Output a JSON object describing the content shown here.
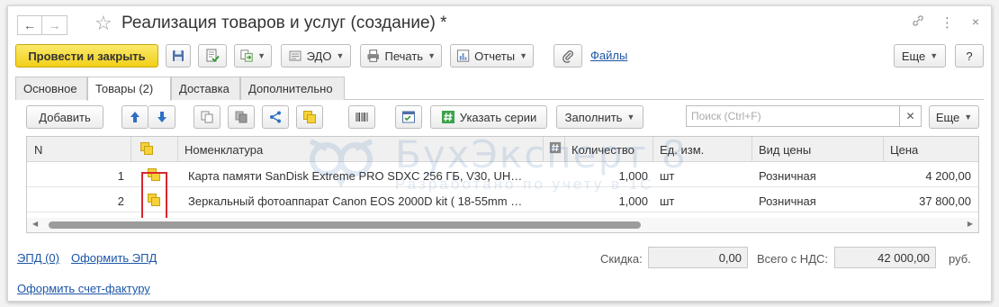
{
  "window": {
    "title": "Реализация товаров и услуг (создание) *"
  },
  "toolbar": {
    "post_and_close": "Провести и закрыть",
    "edo": "ЭДО",
    "print": "Печать",
    "reports": "Отчеты",
    "files": "Файлы",
    "more": "Еще",
    "help": "?"
  },
  "tabs": [
    {
      "label": "Основное"
    },
    {
      "label": "Товары (2)"
    },
    {
      "label": "Доставка"
    },
    {
      "label": "Дополнительно"
    }
  ],
  "table_toolbar": {
    "add": "Добавить",
    "specify_series": "Указать серии",
    "fill": "Заполнить",
    "search_placeholder": "Поиск (Ctrl+F)",
    "more": "Еще"
  },
  "grid": {
    "columns": [
      "N",
      "Номенклатура",
      "Количество",
      "Ед. изм.",
      "Вид цены",
      "Цена"
    ],
    "rows": [
      {
        "n": "1",
        "item": "Карта памяти SanDisk Extreme PRO SDXC 256 ГБ, V30, UH…",
        "qty": "1,000",
        "unit": "шт",
        "price_type": "Розничная",
        "price": "4 200,00"
      },
      {
        "n": "2",
        "item": "Зеркальный фотоаппарат Canon EOS 2000D kit ( 18-55mm …",
        "qty": "1,000",
        "unit": "шт",
        "price_type": "Розничная",
        "price": "37 800,00"
      }
    ],
    "scroll_position": 0
  },
  "watermark": {
    "title": "БухЭксперт 8",
    "subtitle": "Разработано по учету в 1С"
  },
  "footer": {
    "epd": "ЭПД (0)",
    "make_epd": "Оформить ЭПД",
    "invoice": "Оформить счет-фактуру",
    "discount_label": "Скидка:",
    "discount_value": "0,00",
    "total_label": "Всего с НДС:",
    "total_value": "42 000,00",
    "currency": "руб."
  },
  "colors": {
    "primary_button": "#f2cf18",
    "link": "#1d56a8",
    "highlight_border": "#d9262c",
    "icon_yellow": "#f5d23a"
  }
}
